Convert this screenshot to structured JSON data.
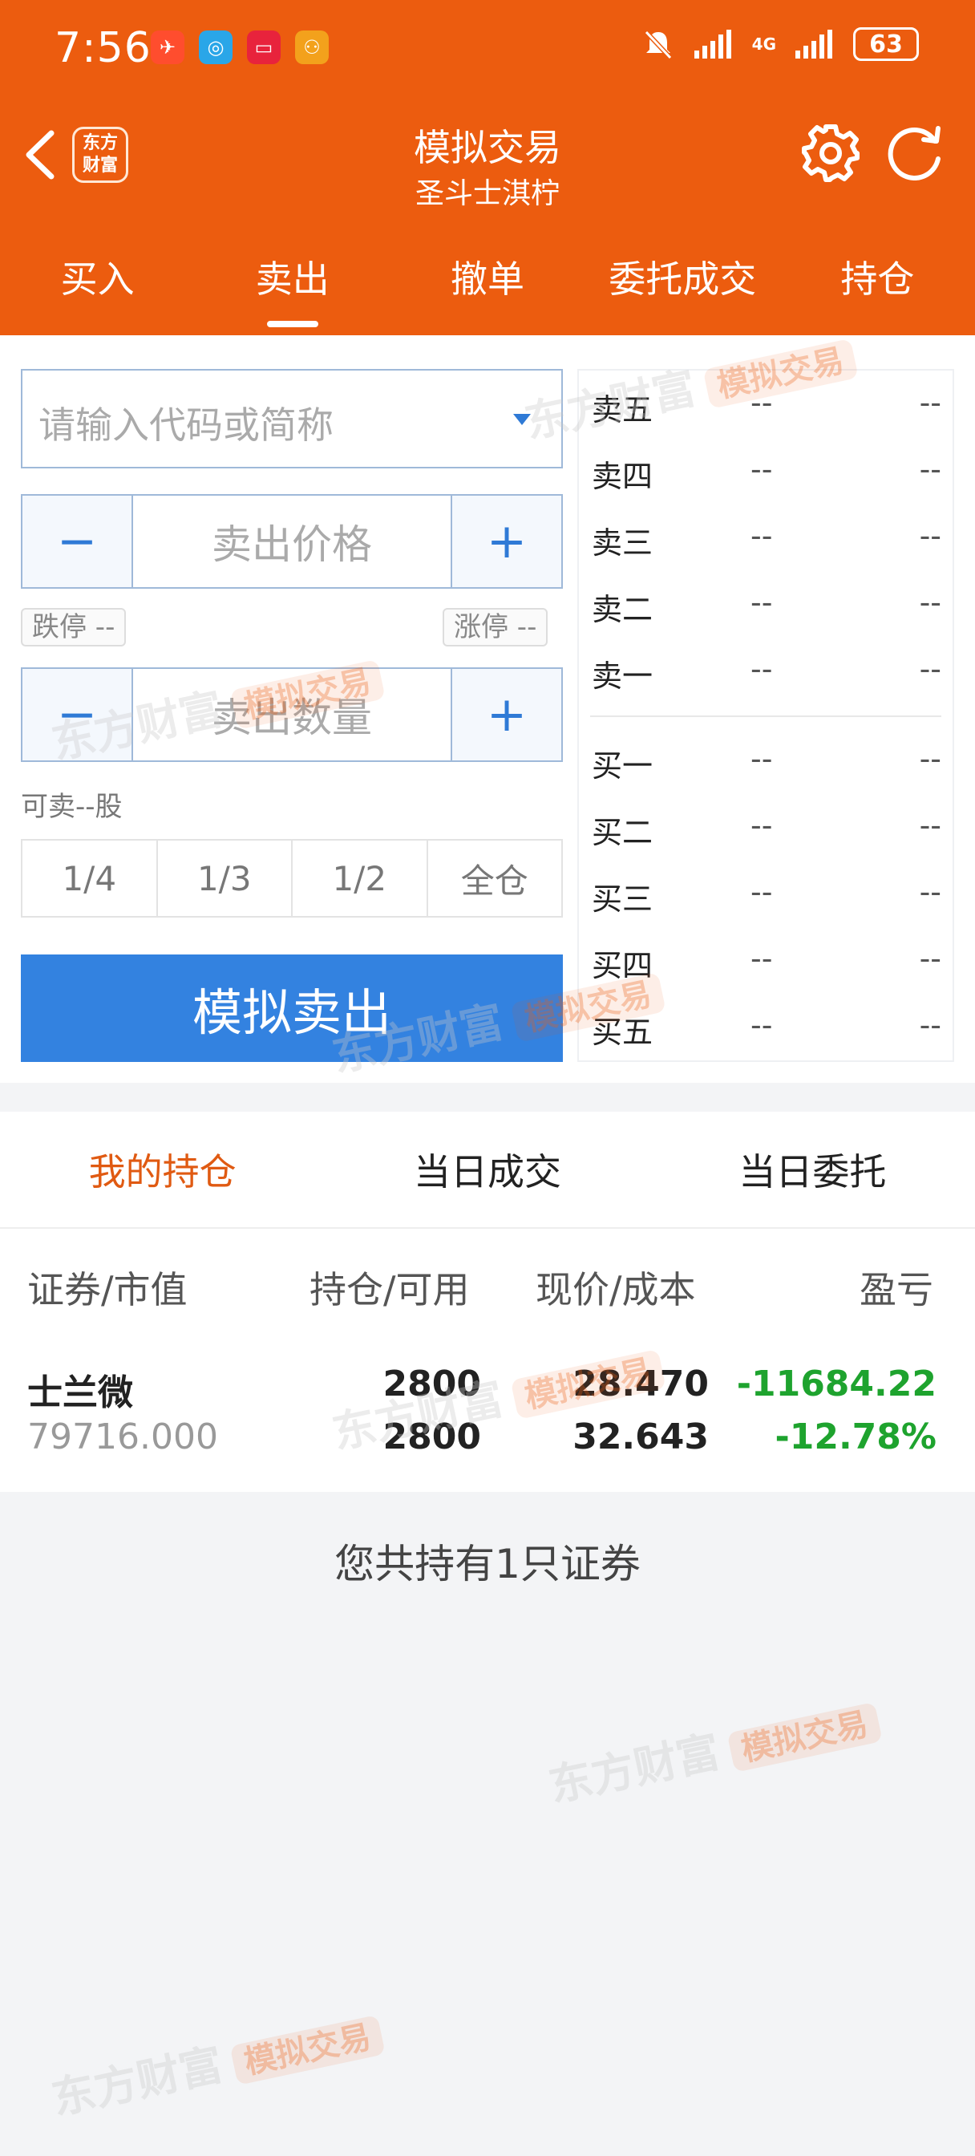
{
  "status": {
    "time": "7:56",
    "battery": "63",
    "network": "4G"
  },
  "header": {
    "title": "模拟交易",
    "subtitle": "圣斗士淇柠",
    "logo_text": "东方财富"
  },
  "tabs": [
    {
      "label": "买入"
    },
    {
      "label": "卖出"
    },
    {
      "label": "撤单"
    },
    {
      "label": "委托成交"
    },
    {
      "label": "持仓"
    }
  ],
  "form": {
    "code_placeholder": "请输入代码或简称",
    "price_placeholder": "卖出价格",
    "qty_placeholder": "卖出数量",
    "minus": "−",
    "plus": "+",
    "limit_down": "跌停 --",
    "limit_up": "涨停 --",
    "sellable": "可卖--股",
    "ratios": [
      "1/4",
      "1/3",
      "1/2",
      "全仓"
    ],
    "submit": "模拟卖出"
  },
  "order_book": {
    "asks": [
      {
        "name": "卖五",
        "price": "--",
        "vol": "--"
      },
      {
        "name": "卖四",
        "price": "--",
        "vol": "--"
      },
      {
        "name": "卖三",
        "price": "--",
        "vol": "--"
      },
      {
        "name": "卖二",
        "price": "--",
        "vol": "--"
      },
      {
        "name": "卖一",
        "price": "--",
        "vol": "--"
      }
    ],
    "bids": [
      {
        "name": "买一",
        "price": "--",
        "vol": "--"
      },
      {
        "name": "买二",
        "price": "--",
        "vol": "--"
      },
      {
        "name": "买三",
        "price": "--",
        "vol": "--"
      },
      {
        "name": "买四",
        "price": "--",
        "vol": "--"
      },
      {
        "name": "买五",
        "price": "--",
        "vol": "--"
      }
    ]
  },
  "position_tabs": [
    "我的持仓",
    "当日成交",
    "当日委托"
  ],
  "table": {
    "headers": [
      "证券/市值",
      "持仓/可用",
      "现价/成本",
      "盈亏"
    ],
    "rows": [
      {
        "name": "士兰微",
        "market_value": "79716.000",
        "holding": "2800",
        "available": "2800",
        "price": "28.470",
        "cost": "32.643",
        "pnl": "-11684.22",
        "pnl_pct": "-12.78%"
      }
    ]
  },
  "summary": "您共持有1只证券",
  "watermark": {
    "brand": "东方财富",
    "tag": "模拟交易"
  },
  "colors": {
    "brand": "#ec5c0f",
    "button": "#3382e0",
    "loss": "#1ea32e"
  }
}
